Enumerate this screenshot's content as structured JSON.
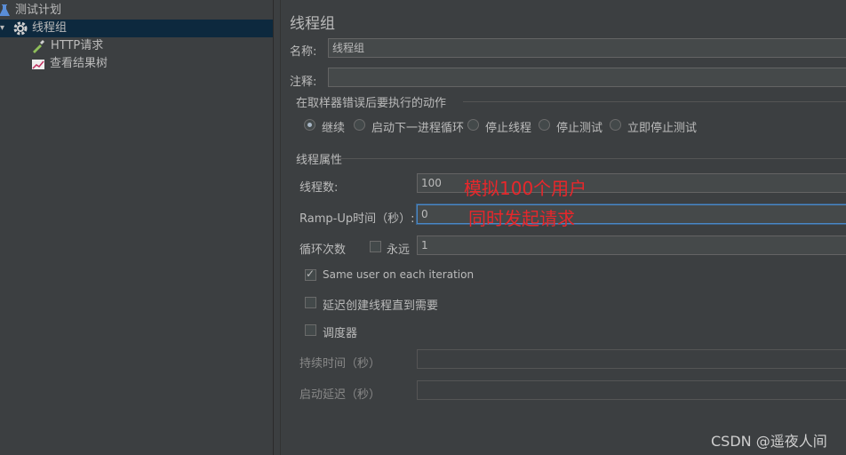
{
  "tree": {
    "items": [
      {
        "label": "测试计划"
      },
      {
        "label": "线程组"
      },
      {
        "label": "HTTP请求"
      },
      {
        "label": "查看结果树"
      }
    ]
  },
  "panel": {
    "title": "线程组",
    "name_label": "名称:",
    "name_value": "线程组",
    "comment_label": "注释:",
    "comment_value": "",
    "error_section": "在取样器错误后要执行的动作",
    "error_actions": [
      "继续",
      "启动下一进程循环",
      "停止线程",
      "停止测试",
      "立即停止测试"
    ],
    "error_selected": "继续",
    "props_section": "线程属性",
    "threads_label": "线程数:",
    "threads_value": "100",
    "threads_note": "模拟100个用户",
    "rampup_label": "Ramp-Up时间（秒）:",
    "rampup_value": "0",
    "rampup_note": "同时发起请求",
    "loop_label": "循环次数",
    "forever_label": "永远",
    "forever_checked": false,
    "loop_value": "1",
    "same_user_label": "Same user on each iteration",
    "same_user_checked": true,
    "delay_label": "延迟创建线程直到需要",
    "delay_checked": false,
    "scheduler_label": "调度器",
    "scheduler_checked": false,
    "duration_label": "持续时间（秒）",
    "duration_value": "",
    "startup_delay_label": "启动延迟（秒）",
    "startup_delay_value": ""
  },
  "watermark": "CSDN @遥夜人间"
}
